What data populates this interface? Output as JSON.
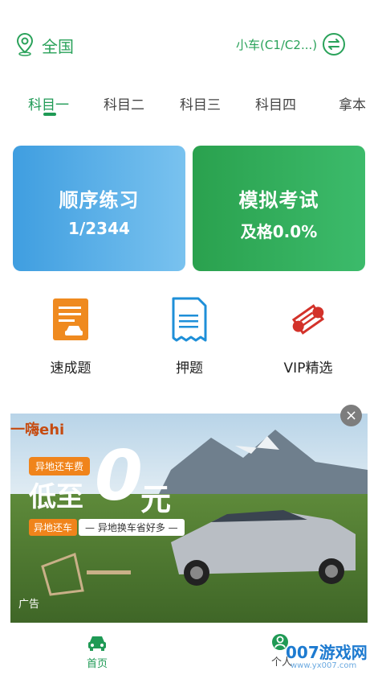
{
  "header": {
    "location": "全国",
    "car_type": "小车(C1/C2...)"
  },
  "tabs": [
    {
      "label": "科目一",
      "active": true
    },
    {
      "label": "科目二",
      "active": false
    },
    {
      "label": "科目三",
      "active": false
    },
    {
      "label": "科目四",
      "active": false
    },
    {
      "label": "拿本",
      "active": false
    }
  ],
  "cards": {
    "order": {
      "title": "顺序练习",
      "progress": "1/2344"
    },
    "exam": {
      "title": "模拟考试",
      "pass_rate": "及格0.0%"
    }
  },
  "quick_actions": [
    {
      "label": "速成题",
      "icon": "document-car-icon"
    },
    {
      "label": "押题",
      "icon": "receipt-icon"
    },
    {
      "label": "VIP精选",
      "icon": "scroll-icon"
    }
  ],
  "ad": {
    "brand": "一嗨ehi",
    "badge": "异地还车费",
    "headline_1": "低至",
    "headline_zero": "0",
    "headline_2": "元",
    "tag_1": "异地还车",
    "tag_2": "— 异地换车省好多 —",
    "label": "广告",
    "close": "×"
  },
  "nav": {
    "home": "首页",
    "me": "个人"
  },
  "watermark": {
    "text": "007游戏网",
    "url": "www.yx007.com"
  },
  "colors": {
    "accent": "#1f9a55",
    "order_card": "#4aa6e4",
    "exam_card": "#2da653"
  }
}
